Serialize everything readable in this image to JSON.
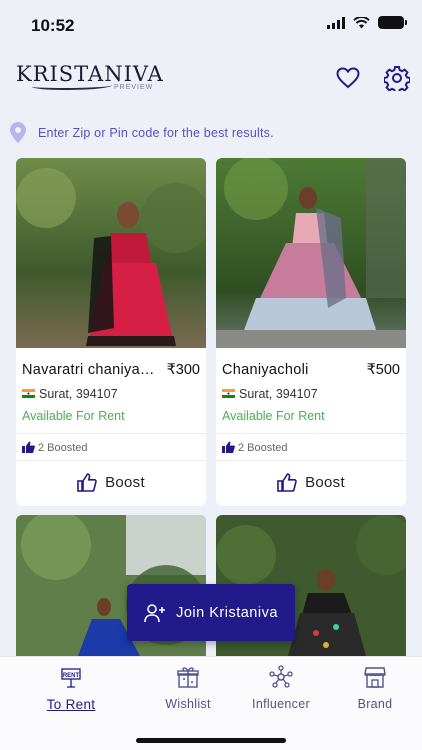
{
  "status_bar": {
    "time": "10:52"
  },
  "header": {
    "logo": "KRISTANIVA",
    "logo_sub": "PREVIEW"
  },
  "zip": {
    "prompt": "Enter Zip or Pin code for the best results."
  },
  "products": [
    {
      "title": "Navaratri  chaniya…",
      "price": "₹300",
      "location": "Surat, 394107",
      "availability": "Available For Rent",
      "boosted": "2 Boosted",
      "boost_label": "Boost"
    },
    {
      "title": "Chaniyacholi",
      "price": "₹500",
      "location": "Surat, 394107",
      "availability": "Available For Rent",
      "boosted": "2 Boosted",
      "boost_label": "Boost"
    }
  ],
  "join_button": {
    "label": "Join Kristaniva"
  },
  "bottom_nav": [
    {
      "label": "To Rent",
      "icon": "rent-sign-icon",
      "active": true
    },
    {
      "label": "Wishlist",
      "icon": "gift-icon",
      "active": false
    },
    {
      "label": "Influencer",
      "icon": "network-icon",
      "active": false
    },
    {
      "label": "Brand",
      "icon": "store-icon",
      "active": false
    }
  ],
  "colors": {
    "accent": "#221a8a",
    "available": "#4caf50",
    "zip_text": "#5a4fc0",
    "background": "#eef0f8"
  }
}
